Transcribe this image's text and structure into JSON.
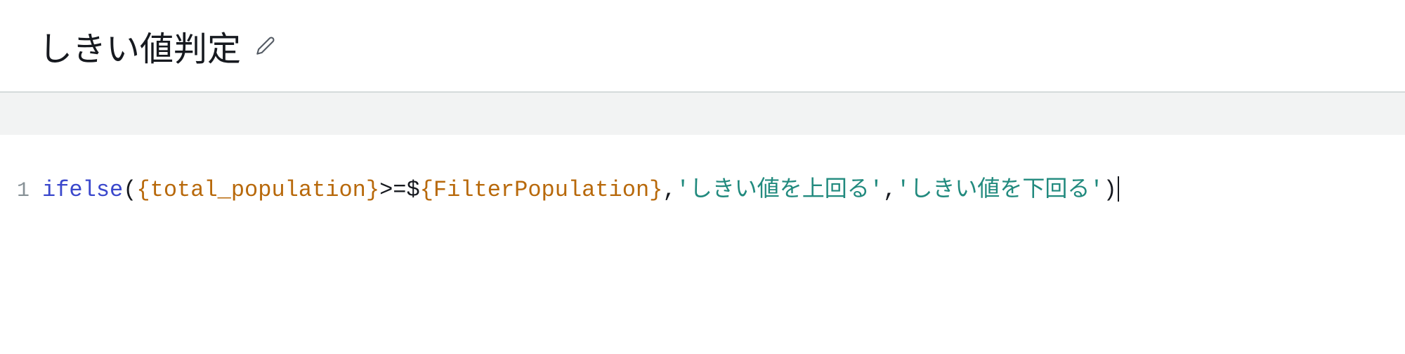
{
  "header": {
    "title": "しきい値判定"
  },
  "editor": {
    "line_number": "1",
    "tokens": {
      "func": "ifelse",
      "lparen": "(",
      "field": "{total_population}",
      "op": ">=",
      "dollar": "$",
      "param": "{FilterPopulation}",
      "comma1": ",",
      "str1": "'しきい値を上回る'",
      "comma2": ",",
      "str2": "'しきい値を下回る'",
      "rparen": ")"
    }
  }
}
